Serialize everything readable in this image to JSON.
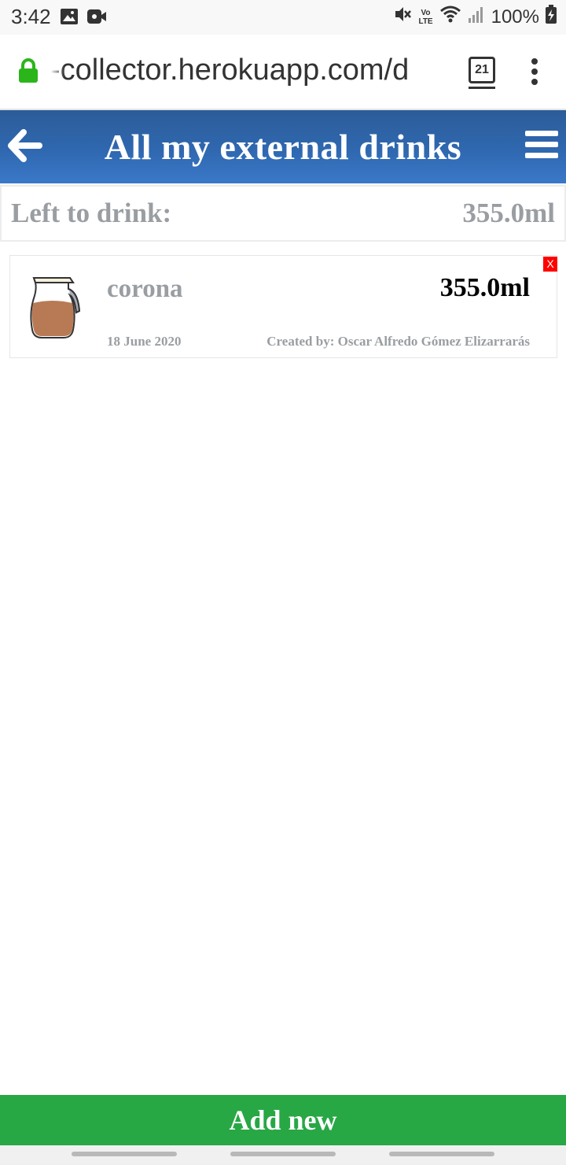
{
  "status_bar": {
    "time": "3:42",
    "battery": "100%",
    "network": "LTE",
    "volte": "Vo"
  },
  "browser": {
    "url": "-collector.herokuapp.com/d",
    "tab_count": "21",
    "accent_color": "#2bb51b"
  },
  "header": {
    "title": "All my external drinks",
    "background_color": "#2f68b0"
  },
  "summary": {
    "label": "Left to drink:",
    "value": "355.0ml"
  },
  "drinks": [
    {
      "name": "corona",
      "volume": "355.0ml",
      "date": "18 June 2020",
      "creator": "Created by: Oscar Alfredo Gómez Elizarrarás",
      "icon": "jug-icon",
      "delete_label": "X"
    }
  ],
  "footer": {
    "add_label": "Add new",
    "button_color": "#28a745"
  }
}
